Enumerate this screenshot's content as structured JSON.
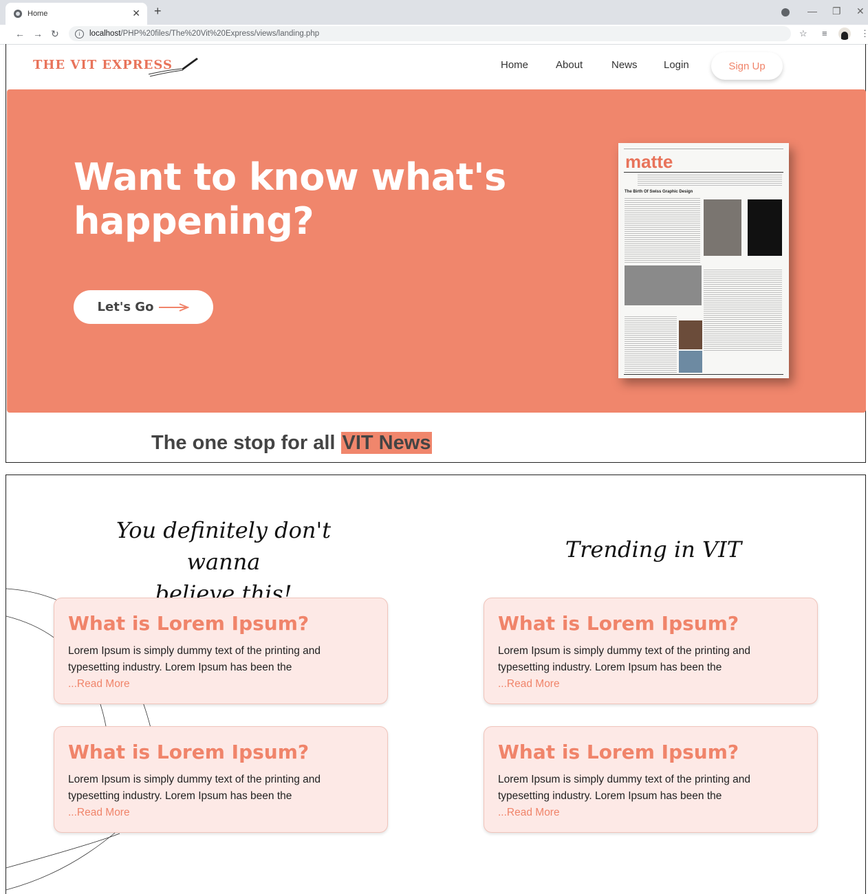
{
  "browser": {
    "tab_title": "Home",
    "url_host": "localhost",
    "url_path": "/PHP%20files/The%20Vit%20Express/views/landing.php"
  },
  "site": {
    "logo": "THE VIT EXPRESS",
    "nav": [
      "Home",
      "About",
      "News",
      "Login"
    ],
    "signup": "Sign Up"
  },
  "hero": {
    "title": "Want to know what's happening?",
    "cta": "Let's Go",
    "paper_title": "matte",
    "paper_headline": "The Birth Of Swiss Graphic Design"
  },
  "tagline": {
    "prefix": "The one stop for all ",
    "highlight": "VIT News"
  },
  "sections": {
    "left_heading_line1": "You definitely don't wanna",
    "left_heading_line2": "believe this!",
    "right_heading": "Trending in VIT"
  },
  "cards": [
    {
      "title": "What is Lorem Ipsum?",
      "body": "Lorem Ipsum is simply dummy text of the printing and typesetting industry. Lorem Ipsum has been the",
      "link": "...Read More"
    },
    {
      "title": "What is Lorem Ipsum?",
      "body": "Lorem Ipsum is simply dummy text of the printing and typesetting industry. Lorem Ipsum has been the",
      "link": "...Read More"
    },
    {
      "title": "What is Lorem Ipsum?",
      "body": "Lorem Ipsum is simply dummy text of the printing and typesetting industry. Lorem Ipsum has been the",
      "link": "...Read More"
    },
    {
      "title": "What is Lorem Ipsum?",
      "body": "Lorem Ipsum is simply dummy text of the printing and typesetting industry. Lorem Ipsum has been the",
      "link": "...Read More"
    }
  ],
  "colors": {
    "accent": "#f0866c",
    "card_bg": "#fde9e6"
  }
}
